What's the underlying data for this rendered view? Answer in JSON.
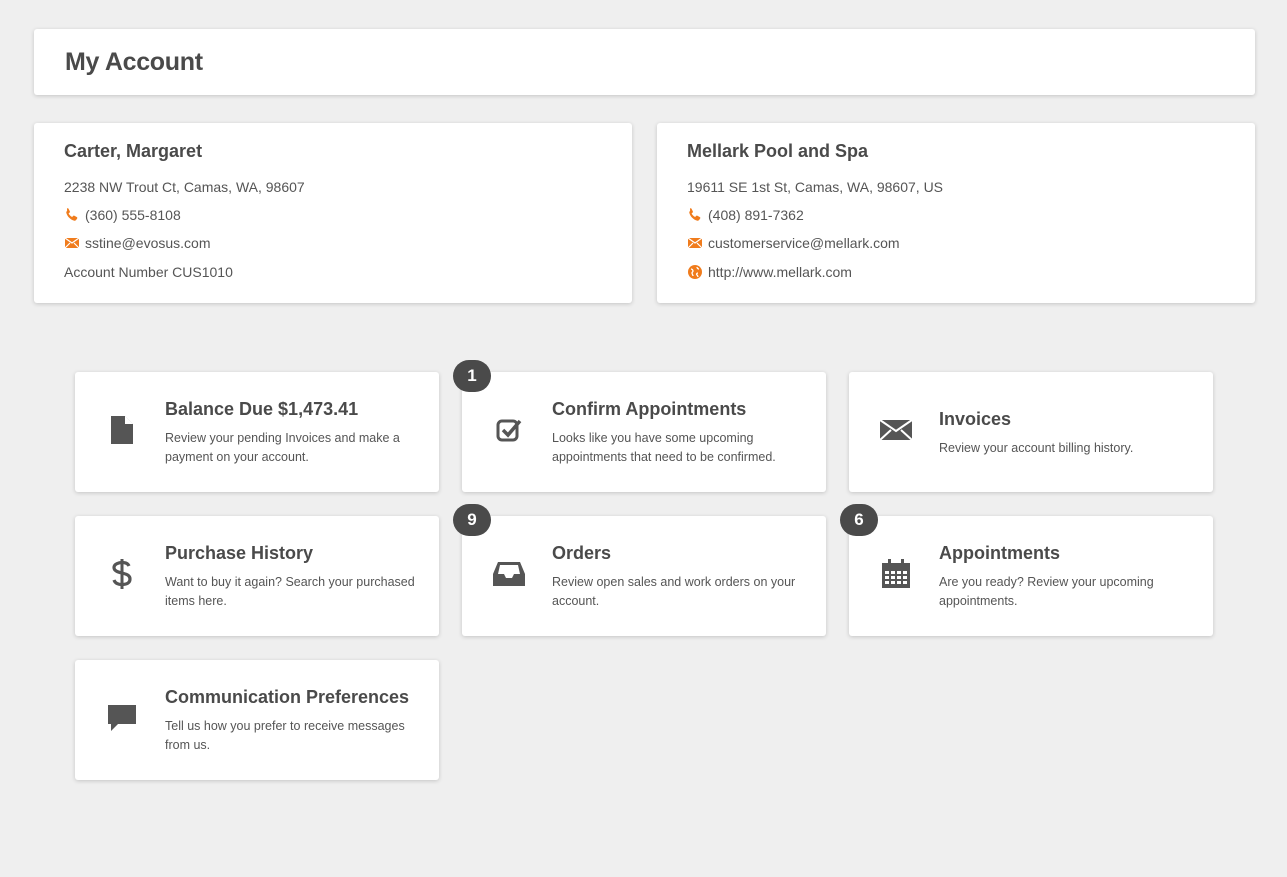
{
  "header": {
    "title": "My Account"
  },
  "customer": {
    "name": "Carter, Margaret",
    "address": "2238 NW Trout Ct, Camas, WA, 98607",
    "phone": "(360) 555-8108",
    "email": "sstine@evosus.com",
    "account_number": "Account Number CUS1010"
  },
  "company": {
    "name": "Mellark Pool and Spa",
    "address": "19611 SE 1st St, Camas, WA, 98607, US",
    "phone": "(408) 891-7362",
    "email": "customerservice@mellark.com",
    "website": "http://www.mellark.com"
  },
  "colors": {
    "accent": "#f07c1d",
    "tile_icon": "#555555",
    "badge": "#4a4a4a"
  },
  "tiles": [
    {
      "icon": "document-icon",
      "title": "Balance Due $1,473.41",
      "desc": "Review your pending Invoices and make a payment on your account."
    },
    {
      "icon": "checkbox-icon",
      "title": "Confirm Appointments",
      "desc": "Looks like you have some upcoming appointments that need to be confirmed.",
      "badge": "1"
    },
    {
      "icon": "envelope-icon",
      "title": "Invoices",
      "desc": "Review your account billing history."
    },
    {
      "icon": "dollar-icon",
      "title": "Purchase History",
      "desc": "Want to buy it again? Search your purchased items here."
    },
    {
      "icon": "inbox-tray-icon",
      "title": "Orders",
      "desc": "Review open sales and work orders on your account.",
      "badge": "9"
    },
    {
      "icon": "calendar-icon",
      "title": "Appointments",
      "desc": "Are you ready? Review your upcoming appointments.",
      "badge": "6"
    },
    {
      "icon": "chat-bubble-icon",
      "title": "Communication Preferences",
      "desc": "Tell us how you prefer to receive messages from us."
    }
  ]
}
